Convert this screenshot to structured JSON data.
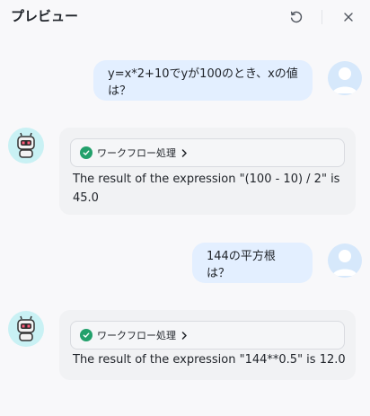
{
  "header": {
    "title": "プレビュー",
    "refresh_icon": "refresh-icon",
    "close_icon": "close-icon"
  },
  "messages": [
    {
      "role": "user",
      "text": "y=x*2+10でyが100のとき、xの値は？"
    },
    {
      "role": "assistant",
      "workflow_label": "ワークフロー処理",
      "workflow_status": "success",
      "text_line1": "The result of the expression \"(100 - 10) / 2\" is",
      "text_line2": "45.0"
    },
    {
      "role": "user",
      "text": "144の平方根は？"
    },
    {
      "role": "assistant",
      "workflow_label": "ワークフロー処理",
      "workflow_status": "success",
      "text_line1": "The result of the expression \"144**0.5\" is 12.0"
    }
  ],
  "colors": {
    "background": "#f8f8fa",
    "user_bubble": "#e3efff",
    "bot_bubble": "#f1f2f4",
    "success": "#22a06b",
    "bot_avatar_bg": "#c9f1f4",
    "user_avatar_bg": "#d6e8fb"
  }
}
